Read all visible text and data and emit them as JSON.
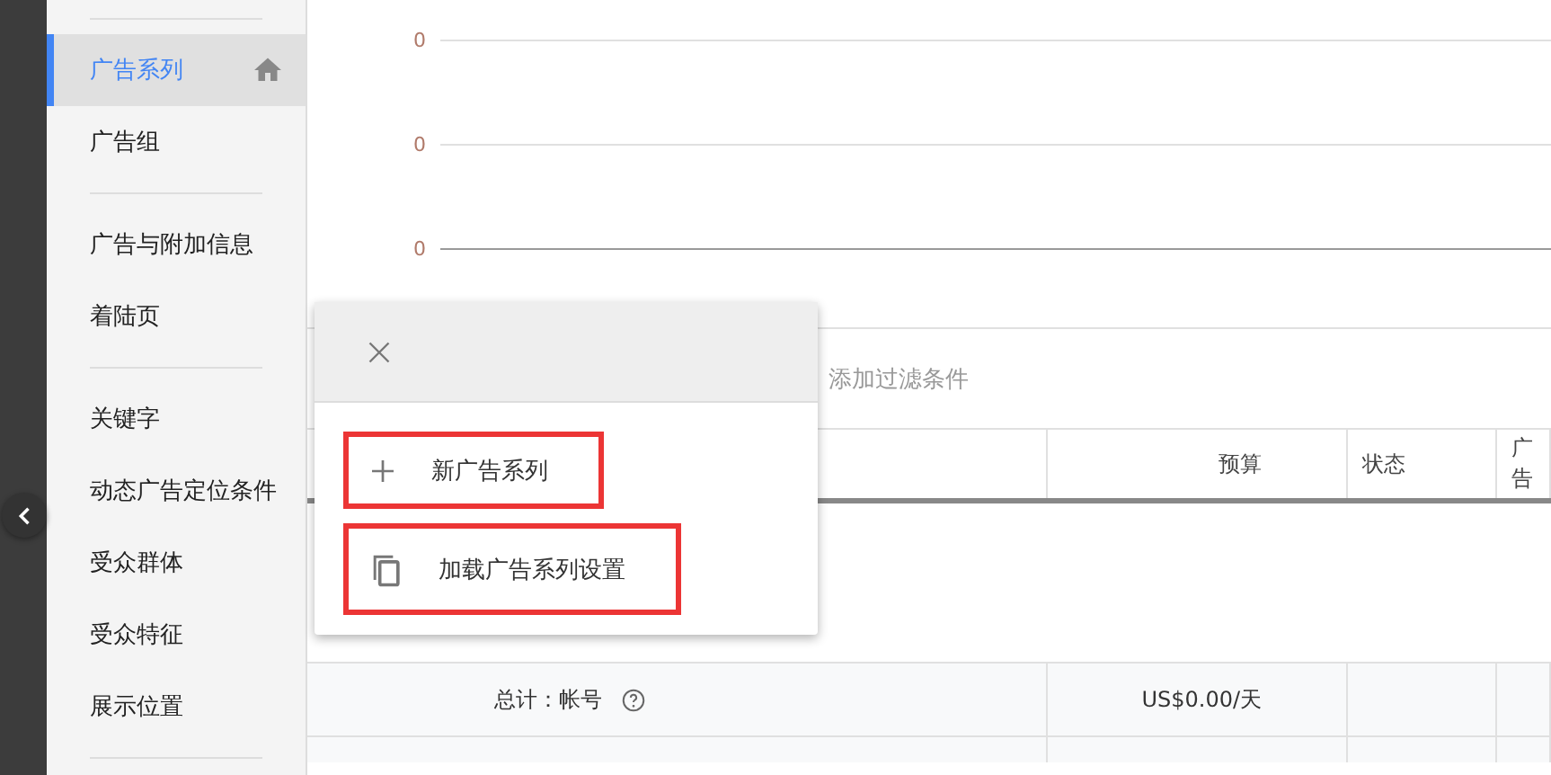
{
  "sidebar": {
    "groups": [
      {
        "items": [
          {
            "label": "广告系列",
            "selected": true,
            "home": true
          },
          {
            "label": "广告组",
            "selected": false,
            "home": false
          }
        ]
      },
      {
        "items": [
          {
            "label": "广告与附加信息",
            "selected": false,
            "home": false
          },
          {
            "label": "着陆页",
            "selected": false,
            "home": false
          }
        ]
      },
      {
        "items": [
          {
            "label": "关键字",
            "selected": false,
            "home": false
          },
          {
            "label": "动态广告定位条件",
            "selected": false,
            "home": false
          },
          {
            "label": "受众群体",
            "selected": false,
            "home": false
          },
          {
            "label": "受众特征",
            "selected": false,
            "home": false
          },
          {
            "label": "展示位置",
            "selected": false,
            "home": false
          }
        ]
      }
    ]
  },
  "chart": {
    "axis_labels": [
      "0",
      "0",
      "0"
    ]
  },
  "filter": {
    "placeholder": "添加过滤条件"
  },
  "table": {
    "columns": [
      "",
      "预算",
      "状态",
      "广告"
    ],
    "total_row": {
      "label": "总计：帐号",
      "budget": "US$0.00/天"
    }
  },
  "popup": {
    "items": [
      {
        "kind": "add",
        "label": "新广告系列",
        "highlighted": true
      },
      {
        "kind": "copy",
        "label": "加载广告系列设置",
        "highlighted": true
      }
    ]
  }
}
